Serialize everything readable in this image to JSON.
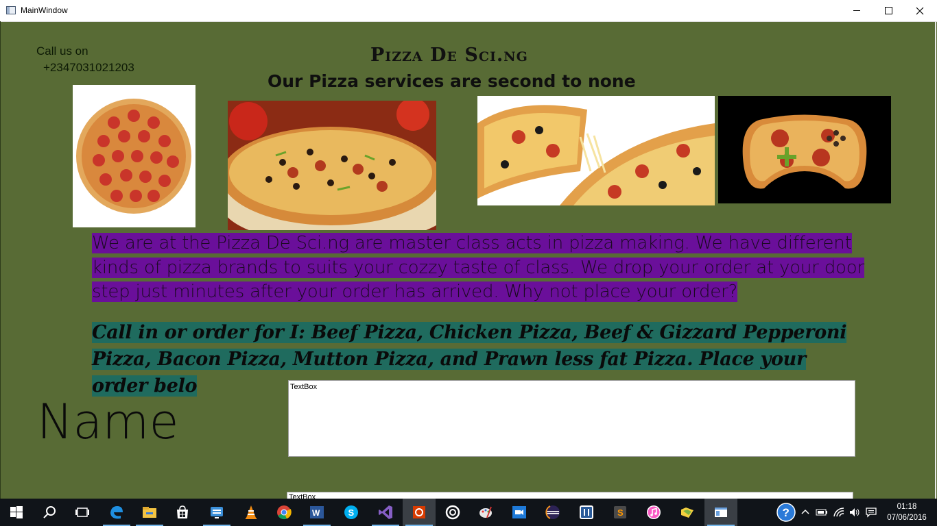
{
  "window": {
    "title": "MainWindow"
  },
  "contact": {
    "label": "Call us on",
    "phone": "+2347031021203"
  },
  "header": {
    "brand": "Pizza De Sci.ng",
    "tagline": "Our Pizza services are second to none"
  },
  "about_text": "We are at the Pizza De Sci.ng are master class acts in pizza making. We have different kinds of  pizza brands to suits your cozzy taste of  class. We drop your order at your door step just minutes after your order has arrived. Why not place your order?",
  "menu_text": "Call in or order for I: Beef Pizza, Chicken Pizza, Beef & Gizzard Pepperoni Pizza, Bacon Pizza, Mutton Pizza, and Prawn less fat Pizza.  Place your order belo",
  "form": {
    "name_label": "Name",
    "name_value": "TextBox",
    "second_value": "TextBox"
  },
  "colors": {
    "background": "#586b35",
    "about_highlight": "#6a0f9a",
    "menu_highlight": "#1f6b5e"
  },
  "taskbar": {
    "icons": [
      "windows-start-icon",
      "search-icon",
      "task-view-icon",
      "edge-icon",
      "file-explorer-icon",
      "store-icon",
      "network-app-icon",
      "vlc-icon",
      "chrome-icon",
      "word-icon",
      "skype-icon",
      "visual-studio-icon",
      "office-app-icon",
      "app-circle-icon",
      "paint-icon",
      "video-call-icon",
      "eclipse-icon",
      "bracket-app-icon",
      "sublime-text-icon",
      "itunes-icon",
      "folder-app-icon",
      "mainwindow-app-icon"
    ],
    "tray_icons": [
      "help-icon",
      "chevron-up-icon",
      "battery-icon",
      "wifi-icon",
      "volume-icon",
      "notification-icon"
    ],
    "time": "01:18",
    "date": "07/06/2016"
  }
}
